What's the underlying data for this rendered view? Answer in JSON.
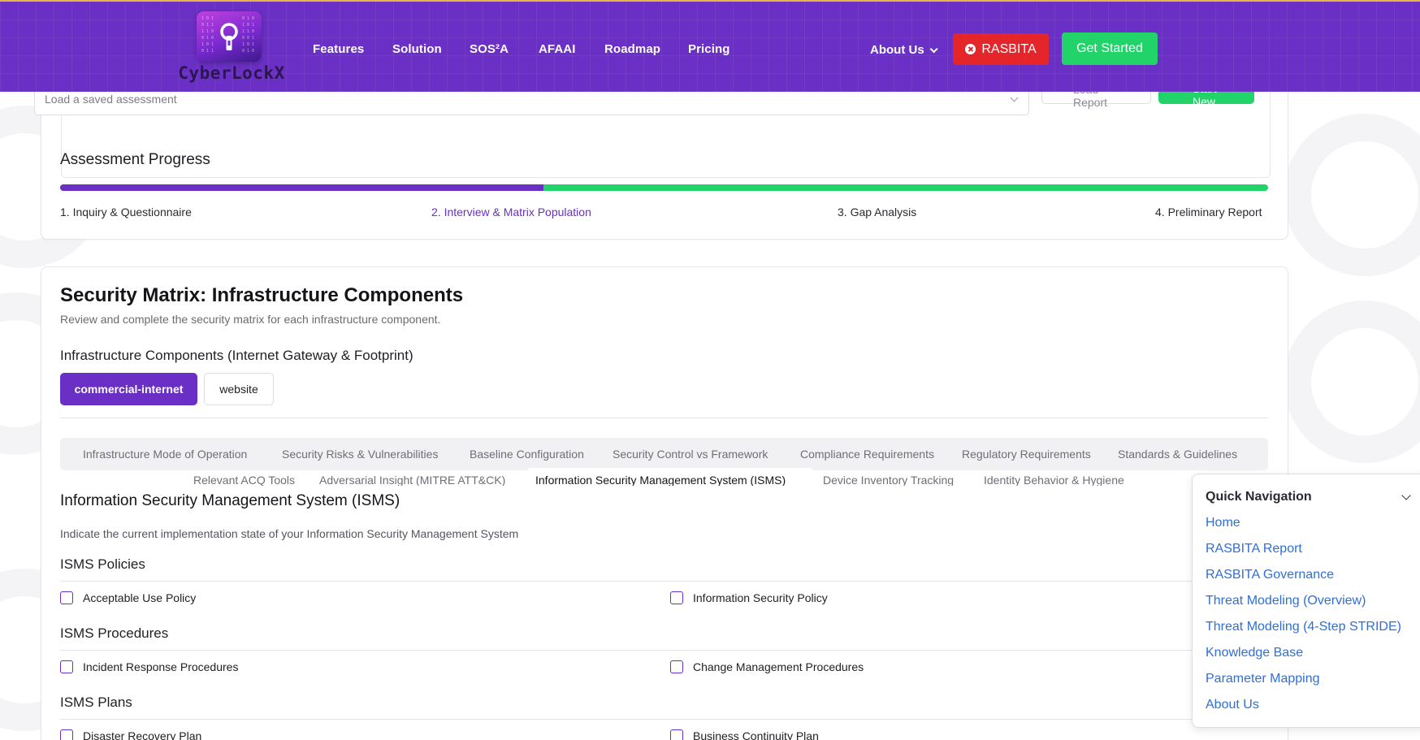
{
  "brand": {
    "name": "CyberLockX"
  },
  "nav": {
    "links": [
      "Features",
      "Solution",
      "SOS²A",
      "AFAAI",
      "Roadmap",
      "Pricing"
    ],
    "about": "About Us",
    "rasbita_button": "RASBITA",
    "get_started_button": "Get Started"
  },
  "assessment": {
    "load_placeholder": "Load a saved assessment",
    "load_report_button": "Load Report",
    "start_new_button": "Start New",
    "progress_title": "Assessment Progress",
    "progress_fraction": 0.4,
    "steps": [
      "1. Inquiry & Questionnaire",
      "2. Interview & Matrix Population",
      "3. Gap Analysis",
      "4. Preliminary Report"
    ],
    "active_step": 1
  },
  "matrix": {
    "title": "Security Matrix: Infrastructure Components",
    "subtitle": "Review and complete the security matrix for each infrastructure component.",
    "components_title": "Infrastructure Components (Internet Gateway & Footprint)",
    "components": [
      "commercial-internet",
      "website"
    ],
    "tabs_row1": [
      "Infrastructure Mode of Operation",
      "Security Risks & Vulnerabilities",
      "Baseline Configuration",
      "Security Control vs Framework",
      "Compliance Requirements",
      "Regulatory Requirements",
      "Standards & Guidelines"
    ],
    "tabs_row2": [
      "Relevant ACQ Tools",
      "Adversarial Insight (MITRE ATT&CK)",
      "Information Security Management System (ISMS)",
      "Device Inventory Tracking",
      "Identity Behavior & Hygiene"
    ],
    "isms": {
      "title": "Information Security Management System (ISMS)",
      "description": "Indicate the current implementation state of your Information Security Management System",
      "groups": [
        {
          "title": "ISMS Policies",
          "items": [
            "Acceptable Use Policy",
            "Information Security Policy"
          ]
        },
        {
          "title": "ISMS Procedures",
          "items": [
            "Incident Response Procedures",
            "Change Management Procedures"
          ]
        },
        {
          "title": "ISMS Plans",
          "items": [
            "Disaster Recovery Plan",
            "Business Continuity Plan"
          ]
        }
      ]
    }
  },
  "quick_nav": {
    "title": "Quick Navigation",
    "links": [
      "Home",
      "RASBITA Report",
      "RASBITA Governance",
      "Threat Modeling (Overview)",
      "Threat Modeling (4-Step STRIDE)",
      "Knowledge Base",
      "Parameter Mapping",
      "About Us"
    ]
  },
  "colors": {
    "brand_purple": "#6a2fc4",
    "accent_green": "#22d36a",
    "rasbita_red": "#e4262b",
    "link_blue": "#2f6fd6"
  }
}
